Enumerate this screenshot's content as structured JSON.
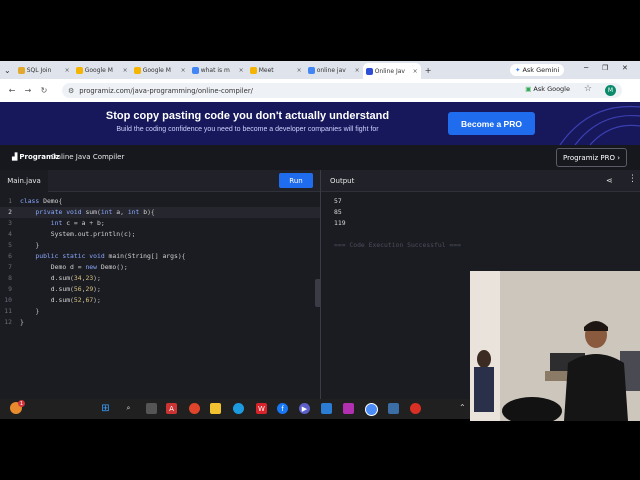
{
  "browser": {
    "tabs": [
      {
        "label": "SQL Join",
        "color": "#e2a82c"
      },
      {
        "label": "Google M",
        "color": "#f4b400"
      },
      {
        "label": "Google M",
        "color": "#f4b400"
      },
      {
        "label": "what is m",
        "color": "#4285f4"
      },
      {
        "label": "Meet",
        "color": "#f4b400"
      },
      {
        "label": "online jav",
        "color": "#4285f4"
      },
      {
        "label": "Online Jav",
        "color": "#2c4fd6"
      }
    ],
    "gemini_label": "Ask Gemini",
    "url": "programiz.com/java-programming/online-compiler/",
    "ask_google": "Ask Google",
    "avatar_letter": "M"
  },
  "banner": {
    "title": "Stop copy pasting code you don't actually understand",
    "subtitle": "Build the coding confidence you need to become a developer companies will fight for",
    "button": "Become a PRO"
  },
  "app": {
    "logo": "Programiz",
    "title": "Online Java Compiler",
    "pro_link": "Programiz PRO ›"
  },
  "editor": {
    "file_tab": "Main.java",
    "run_label": "Run",
    "current_line": 2,
    "lines": [
      "class Demo{",
      "    private void sum(int a, int b){",
      "        int c = a + b;",
      "        System.out.println(c);",
      "    }",
      "    public static void main(String[] args){",
      "        Demo d = new Demo();",
      "        d.sum(34,23);",
      "        d.sum(56,29);",
      "        d.sum(52,67);",
      "    }",
      "}"
    ]
  },
  "output": {
    "tab_label": "Output",
    "lines": [
      "57",
      "85",
      "119"
    ],
    "status": "=== Code Execution Successful ==="
  }
}
